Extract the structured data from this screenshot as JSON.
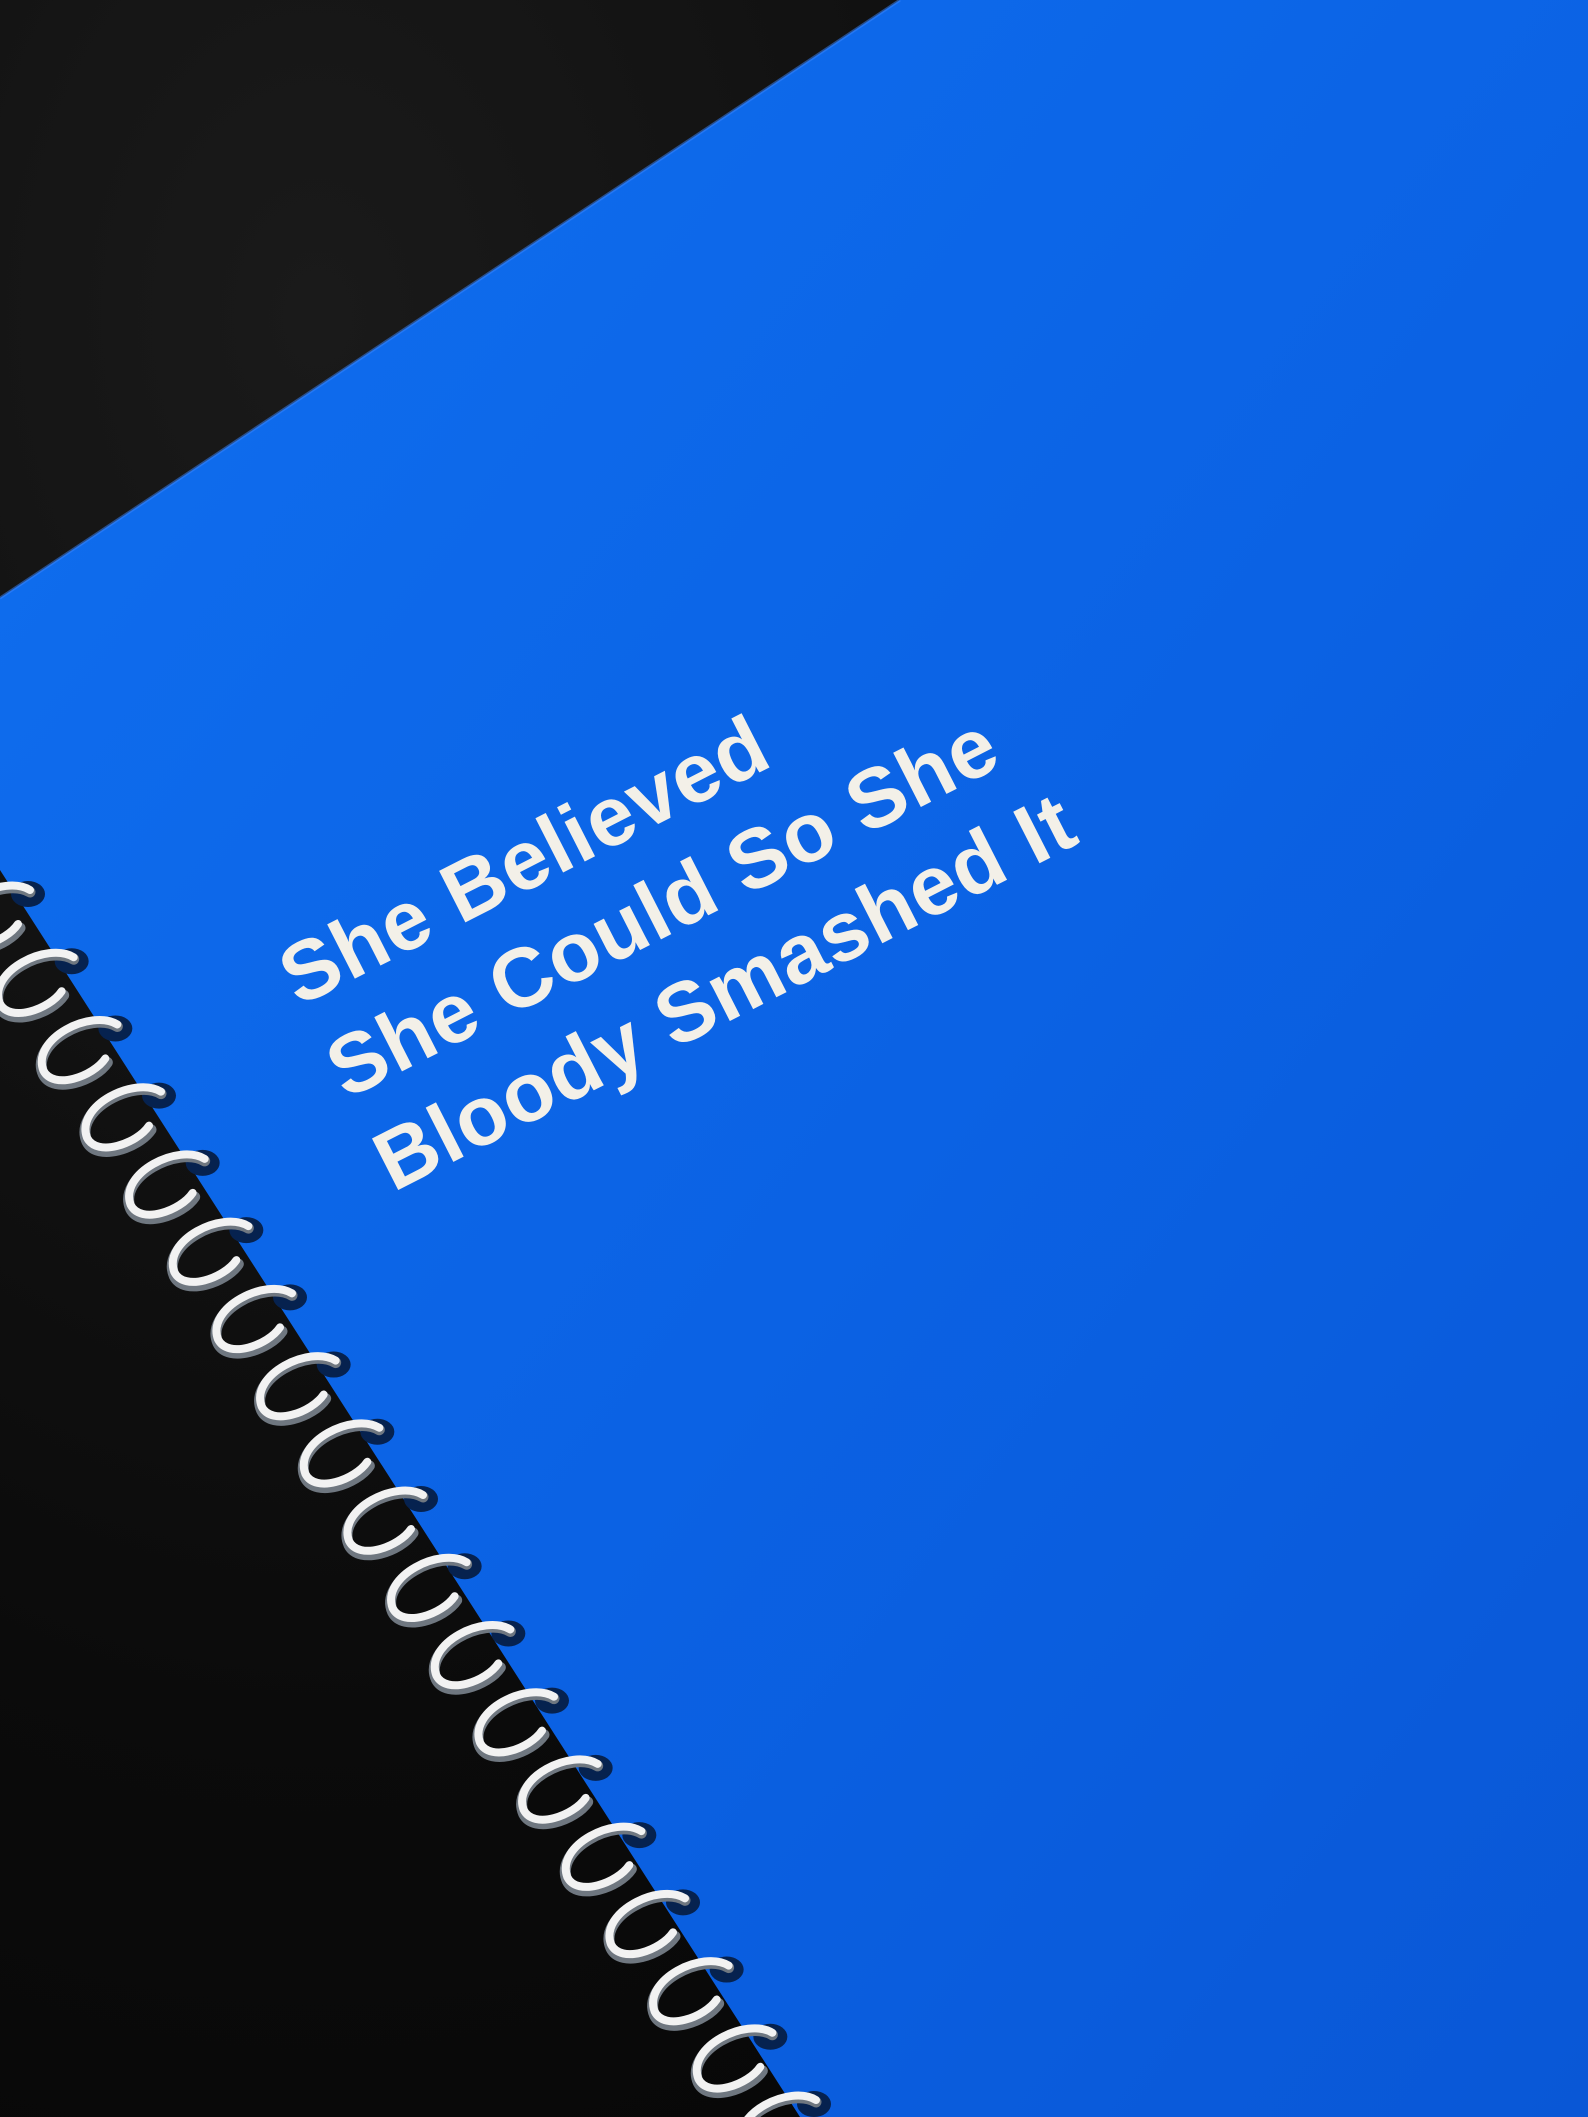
{
  "notebook": {
    "slogan_lines": [
      "She Believed",
      "She Could So She",
      "Bloody Smashed It"
    ],
    "cover_color": "#0b63e6",
    "text_color": "#f3f0e8",
    "coil_color": "#f2f2f2",
    "background_color": "#0a0a0a"
  }
}
